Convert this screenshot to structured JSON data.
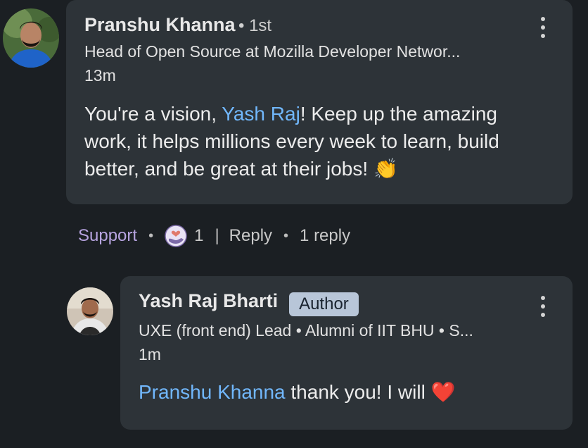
{
  "comment": {
    "author_name": "Pranshu Khanna",
    "connection_degree": "• 1st",
    "headline": "Head of Open Source at Mozilla Developer Networ...",
    "timestamp": "13m",
    "text_before": "You're a vision, ",
    "mention": "Yash Raj",
    "text_after": "! Keep up the amazing work, it helps millions every week to learn, build better, and be great at their jobs! ",
    "emoji": "👏",
    "support_label": "Support",
    "reaction_count": "1",
    "reply_label": "Reply",
    "replies_label": "1 reply",
    "separator_dot": "•",
    "separator_bar": "|"
  },
  "reply": {
    "author_name": "Yash Raj Bharti",
    "badge": "Author",
    "headline": "UXE (front end) Lead • Alumni of IIT BHU • S...",
    "timestamp": "1m",
    "mention": "Pranshu Khanna",
    "text": " thank you! I will ",
    "emoji": "❤️"
  },
  "colors": {
    "background": "#1b1f23",
    "card": "#2d3338",
    "mention": "#71b7fb",
    "support": "#b7a4e0",
    "badge": "#b8c6d8"
  },
  "icons": [
    "more-options-icon",
    "support-reaction-icon"
  ]
}
